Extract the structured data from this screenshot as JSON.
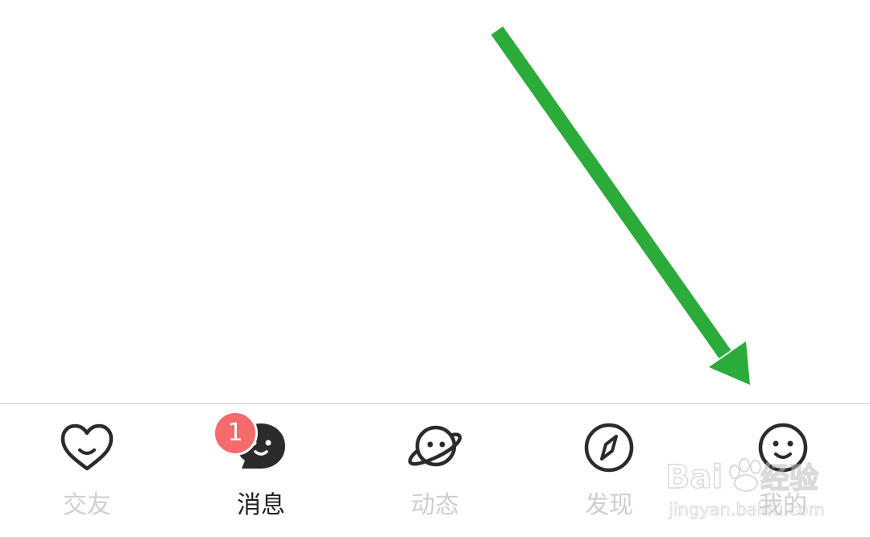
{
  "tabbar": {
    "tabs": [
      {
        "label": "交友",
        "icon": "heart-smile-icon",
        "active": false
      },
      {
        "label": "消息",
        "icon": "chat-bubble-icon",
        "active": true
      },
      {
        "label": "动态",
        "icon": "planet-icon",
        "active": false
      },
      {
        "label": "发现",
        "icon": "compass-icon",
        "active": false
      },
      {
        "label": "我的",
        "icon": "smiley-face-icon",
        "active": false
      }
    ],
    "badge_count": "1"
  },
  "annotation": {
    "arrow_color": "#2aab3a",
    "points_to": "我的"
  },
  "watermark": {
    "brand": "Bai du 经验",
    "url": "jingyan.baidu.com"
  },
  "colors": {
    "inactive_label": "#cfcfcf",
    "active_label": "#1f1f1f",
    "icon_stroke": "#2b2b2b",
    "badge": "#f56a6a"
  }
}
